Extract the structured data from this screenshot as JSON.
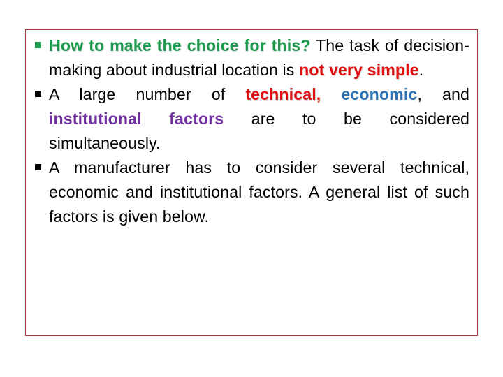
{
  "slide": {
    "frame_color": "#a83a3a",
    "colors": {
      "green": "#1e9a4e",
      "red": "#e01010",
      "blue": "#2e74b5",
      "purple": "#7030a0"
    },
    "bullets": [
      {
        "bullet_icon": "square-bullet-green",
        "question": "How to make the choice for this?",
        "text_1": " The task of decision-making about industrial location is ",
        "emphasis": "not very simple",
        "text_2": "."
      },
      {
        "bullet_icon": "square-bullet-black",
        "text_1": "A large number of ",
        "technical": "technical,",
        "space_1": " ",
        "economic": "economic",
        "text_2": ", and ",
        "institutional": "institutional factors",
        "text_3": " are to be considered simultaneously."
      },
      {
        "bullet_icon": "square-bullet-black",
        "text": "A manufacturer has to consider several technical, economic and institutional factors. A general list of such factors is given below."
      }
    ]
  }
}
